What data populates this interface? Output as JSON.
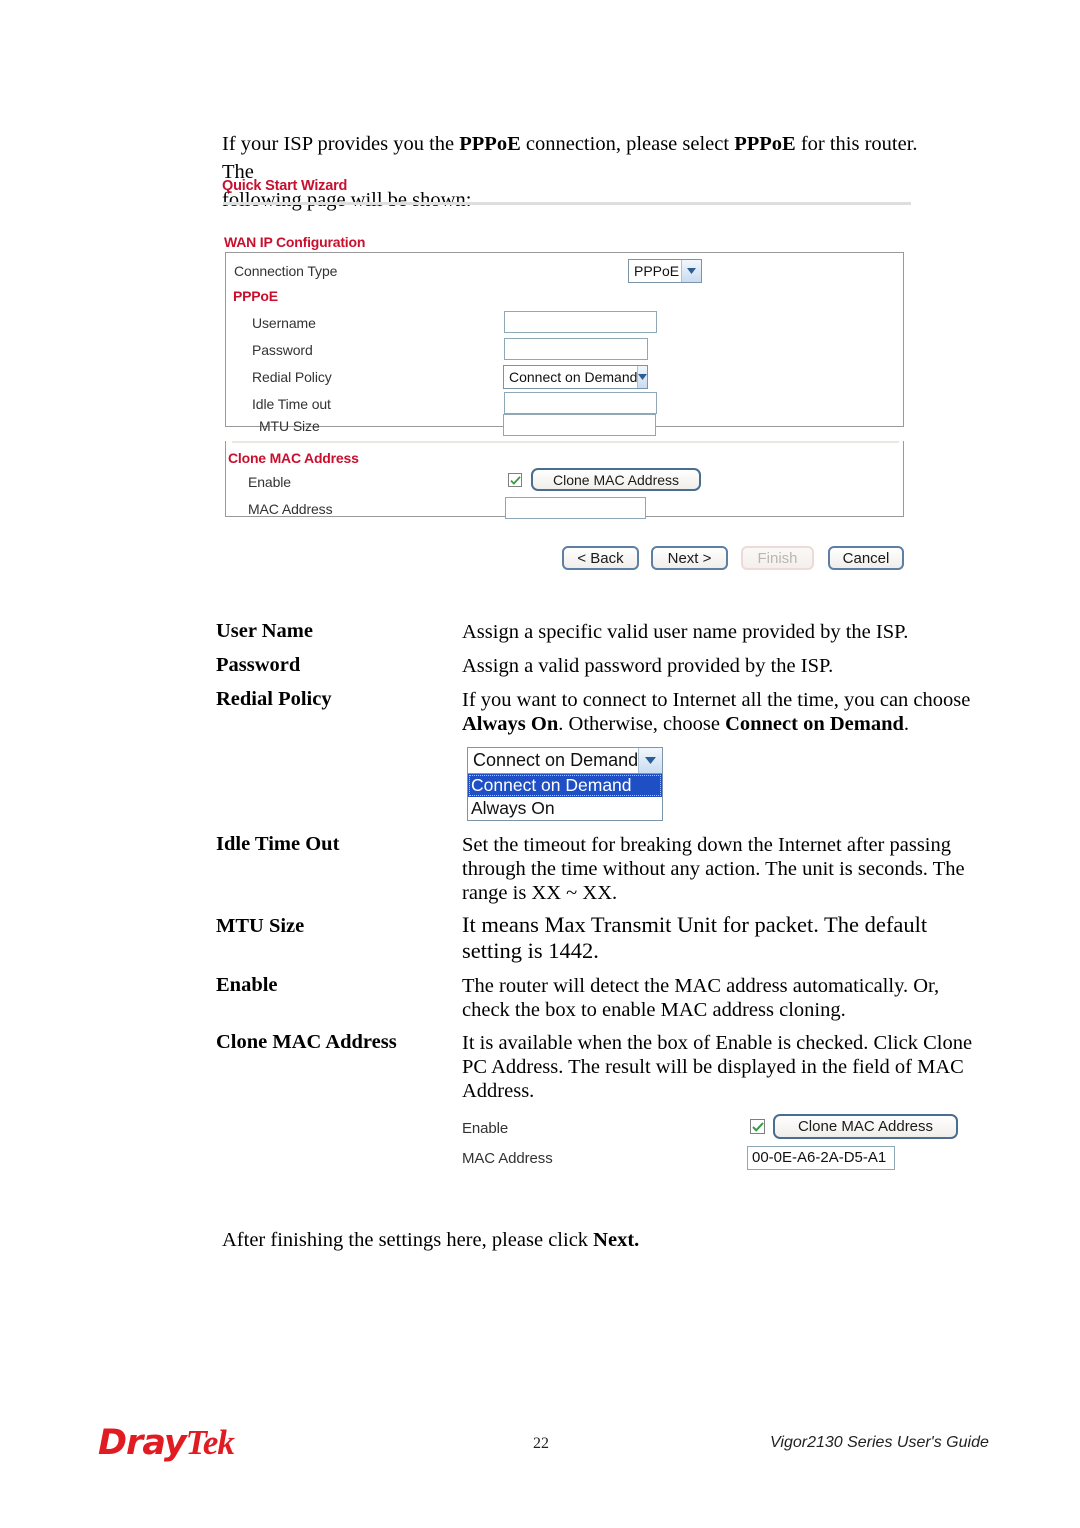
{
  "intro": {
    "line1_a": "If your ISP provides you the ",
    "line1_b": "PPPoE",
    "line1_c": " connection, please select ",
    "line1_d": "PPPoE",
    "line1_e": " for this router. The",
    "line2": "following page will be shown:"
  },
  "screenshot": {
    "wizard_title": "Quick Start Wizard",
    "section_wan": "WAN IP Configuration",
    "connection_type_label": "Connection Type",
    "connection_type_value": "PPPoE",
    "section_pppoe": "PPPoE",
    "username_label": "Username",
    "username_value": "",
    "password_label": "Password",
    "password_value": "",
    "redial_policy_label": "Redial Policy",
    "redial_policy_value": "Connect on Demand",
    "idle_time_out_label": "Idle Time out",
    "idle_time_out_value": "",
    "mtu_size_label": "MTU Size",
    "mtu_size_value": "",
    "section_clone": "Clone MAC Address",
    "enable_label": "Enable",
    "clone_button_label": "Clone MAC Address",
    "mac_address_label": "MAC Address",
    "mac_address_value": "",
    "buttons": {
      "back": "< Back",
      "next": "Next >",
      "finish": "Finish",
      "cancel": "Cancel"
    }
  },
  "definitions": [
    {
      "term": "User Name",
      "lines": [
        "Assign a specific valid user name provided by the ISP."
      ]
    },
    {
      "term": "Password",
      "lines": [
        "Assign a valid password provided by the ISP."
      ]
    },
    {
      "term": "Redial Policy",
      "lines": [
        "If you want to connect to Internet all the time, you can choose"
      ],
      "line2_a": "Always On",
      "line2_b": ". Otherwise, choose ",
      "line2_c": "Connect on Demand",
      "line2_d": "."
    },
    {
      "term": "Idle Time Out",
      "lines": [
        "Set the timeout for breaking down the Internet after passing",
        "through the time without any action. The unit is seconds. The",
        "range is XX ~ XX."
      ]
    },
    {
      "term": "MTU Size",
      "lines": [
        "It means Max Transmit Unit for packet. The default",
        "setting is 1442."
      ]
    },
    {
      "term": "Enable",
      "lines": [
        "The router will detect the MAC address automatically. Or,",
        "check the box to enable MAC address cloning."
      ]
    },
    {
      "term": "Clone MAC Address",
      "lines": [
        "It is available when the box of Enable is checked. Click Clone",
        "PC Address. The result will be displayed in the field of MAC",
        "Address."
      ]
    }
  ],
  "redial_dropdown": {
    "selected": "Connect on Demand",
    "options": [
      "Connect on Demand",
      "Always On"
    ]
  },
  "clone_snippet": {
    "enable_label": "Enable",
    "clone_button_label": "Clone MAC Address",
    "mac_address_label": "MAC Address",
    "mac_address_value": "00-0E-A6-2A-D5-A1"
  },
  "closing": {
    "text_a": "After finishing the settings here, please click ",
    "text_b": "Next."
  },
  "footer": {
    "logo_part1": "Dray",
    "logo_part2": "Tek",
    "page_number": "22",
    "guide": "Vigor2130 Series User's Guide"
  },
  "colors": {
    "brand_red": "#c8102e",
    "logo_red": "#e11b22",
    "select_highlight": "#1f4fc4",
    "check_green": "#2e9e3e"
  }
}
